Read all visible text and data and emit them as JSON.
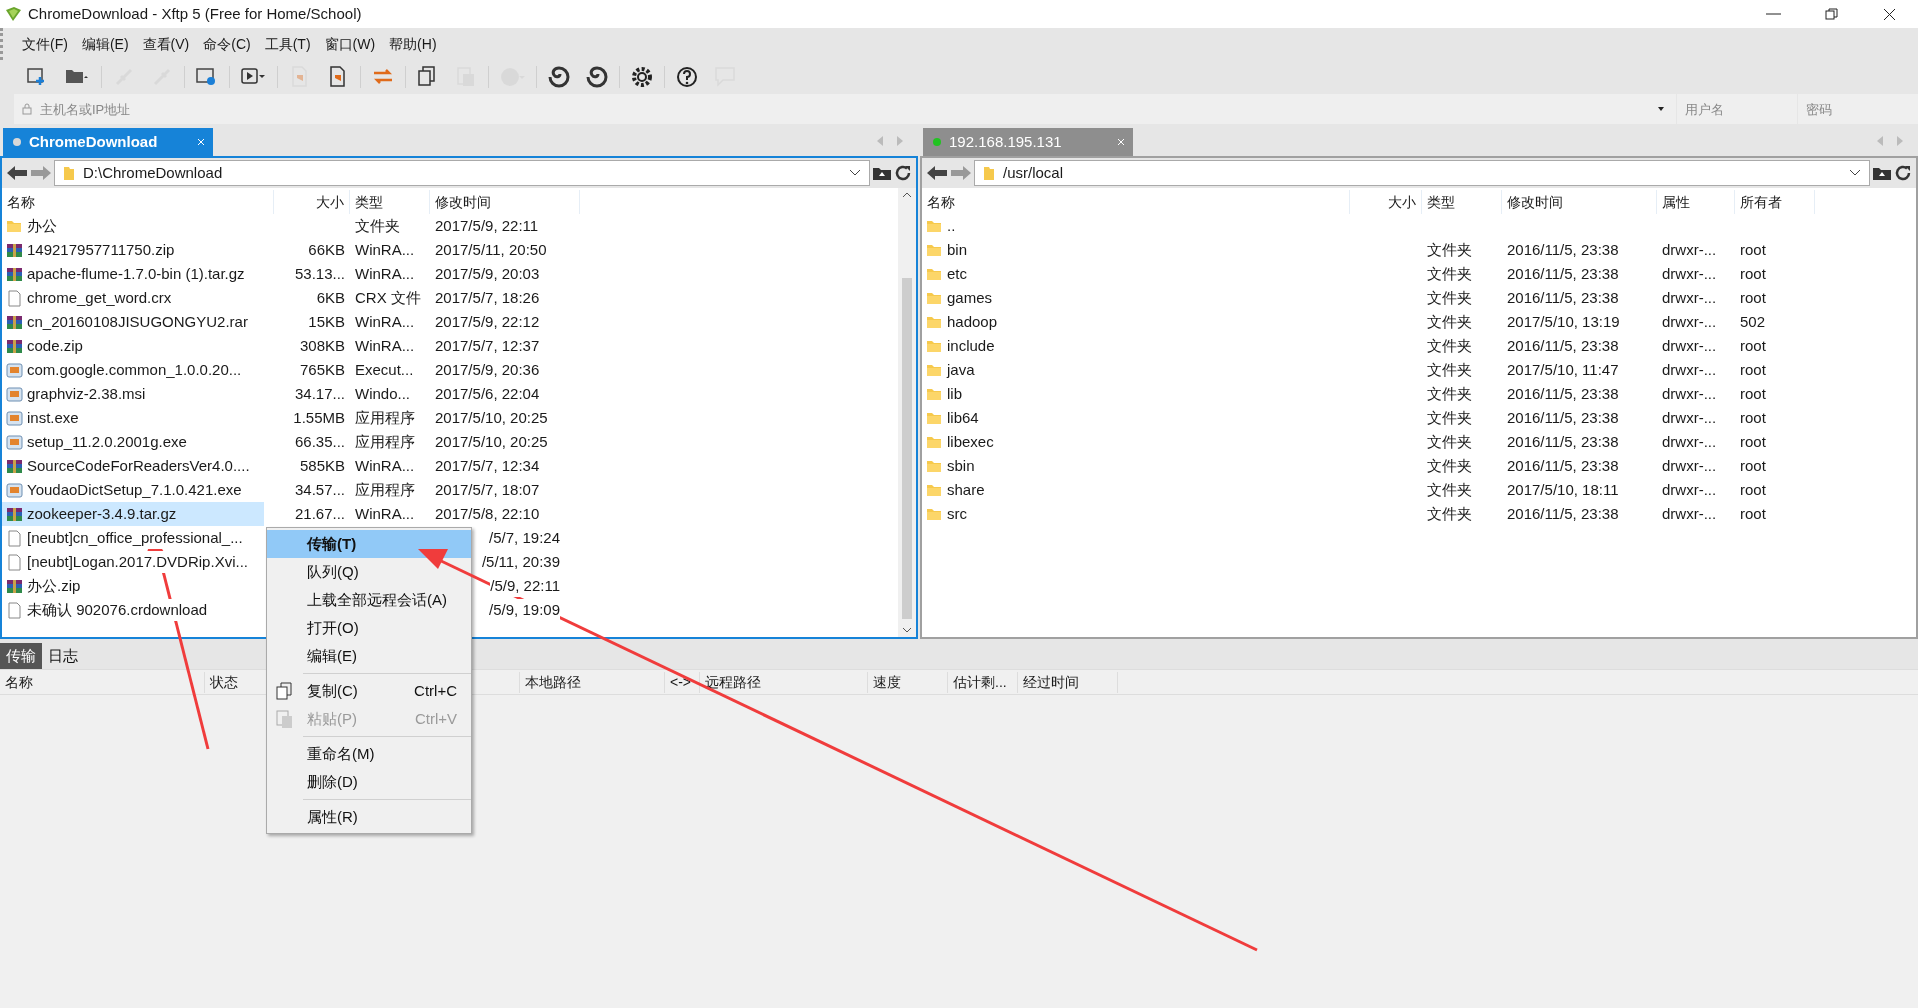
{
  "window": {
    "title": "ChromeDownload - Xftp 5 (Free for Home/School)"
  },
  "menu": [
    "文件(F)",
    "编辑(E)",
    "查看(V)",
    "命令(C)",
    "工具(T)",
    "窗口(W)",
    "帮助(H)"
  ],
  "toolbar": [
    {
      "kind": "new",
      "disabled": false
    },
    {
      "kind": "open",
      "disabled": false
    },
    {
      "kind": "connect",
      "disabled": true
    },
    {
      "kind": "disconnect",
      "disabled": true
    },
    {
      "kind": "properties",
      "disabled": false
    },
    {
      "kind": "play",
      "disabled": false
    },
    {
      "kind": "doc",
      "disabled": true
    },
    {
      "kind": "doc",
      "disabled": false
    },
    {
      "kind": "swap",
      "disabled": false
    },
    {
      "kind": "copy",
      "disabled": false
    },
    {
      "kind": "paste",
      "disabled": true
    },
    {
      "kind": "globe",
      "disabled": true
    },
    {
      "kind": "shell",
      "disabled": false
    },
    {
      "kind": "shell",
      "disabled": false
    },
    {
      "kind": "gear",
      "disabled": false
    },
    {
      "kind": "help",
      "disabled": false
    },
    {
      "kind": "chat",
      "disabled": true
    }
  ],
  "address_bar": {
    "host_placeholder": "主机名或IP地址",
    "user_placeholder": "用户名",
    "password_placeholder": "密码"
  },
  "local": {
    "tab": {
      "label": "ChromeDownload",
      "selected": true
    },
    "path": "D:\\ChromeDownload",
    "columns": [
      "名称",
      "大小",
      "类型",
      "修改时间"
    ],
    "rows": [
      {
        "kind": "folder",
        "name": "办公",
        "size": "",
        "type": "文件夹",
        "modified": "2017/5/9, 22:11",
        "selected": false
      },
      {
        "kind": "archive",
        "name": "149217957711750.zip",
        "size": "66KB",
        "type": "WinRA...",
        "modified": "2017/5/11, 20:50",
        "selected": false
      },
      {
        "kind": "archive",
        "name": "apache-flume-1.7.0-bin (1).tar.gz",
        "size": "53.13...",
        "type": "WinRA...",
        "modified": "2017/5/9, 20:03",
        "selected": false
      },
      {
        "kind": "file",
        "name": "chrome_get_word.crx",
        "size": "6KB",
        "type": "CRX 文件",
        "modified": "2017/5/7, 18:26",
        "selected": false
      },
      {
        "kind": "archive",
        "name": "cn_20160108JISUGONGYU2.rar",
        "size": "15KB",
        "type": "WinRA...",
        "modified": "2017/5/9, 22:12",
        "selected": false
      },
      {
        "kind": "archive",
        "name": "code.zip",
        "size": "308KB",
        "type": "WinRA...",
        "modified": "2017/5/7, 12:37",
        "selected": false
      },
      {
        "kind": "app",
        "name": "com.google.common_1.0.0.20...",
        "size": "765KB",
        "type": "Execut...",
        "modified": "2017/5/9, 20:36",
        "selected": false
      },
      {
        "kind": "app",
        "name": "graphviz-2.38.msi",
        "size": "34.17...",
        "type": "Windo...",
        "modified": "2017/5/6, 22:04",
        "selected": false
      },
      {
        "kind": "app",
        "name": "inst.exe",
        "size": "1.55MB",
        "type": "应用程序",
        "modified": "2017/5/10, 20:25",
        "selected": false
      },
      {
        "kind": "app",
        "name": "setup_11.2.0.2001g.exe",
        "size": "66.35...",
        "type": "应用程序",
        "modified": "2017/5/10, 20:25",
        "selected": false
      },
      {
        "kind": "archive",
        "name": "SourceCodeForReadersVer4.0....",
        "size": "585KB",
        "type": "WinRA...",
        "modified": "2017/5/7, 12:34",
        "selected": false
      },
      {
        "kind": "app",
        "name": "YoudaoDictSetup_7.1.0.421.exe",
        "size": "34.57...",
        "type": "应用程序",
        "modified": "2017/5/7, 18:07",
        "selected": false
      },
      {
        "kind": "archive",
        "name": "zookeeper-3.4.9.tar.gz",
        "size": "21.67...",
        "type": "WinRA...",
        "modified": "2017/5/8, 22:10",
        "selected": true
      },
      {
        "kind": "file",
        "name": "[neubt]cn_office_professional_...",
        "modified": "/5/7, 19:24",
        "selected": false
      },
      {
        "kind": "file",
        "name": "[neubt]Logan.2017.DVDRip.Xvi...",
        "modified": "/5/11, 20:39",
        "selected": false
      },
      {
        "kind": "archive",
        "name": "办公.zip",
        "modified": "/5/9, 22:11",
        "selected": false
      },
      {
        "kind": "file",
        "name": "未确认 902076.crdownload",
        "modified": "/5/9, 19:09",
        "selected": false
      }
    ]
  },
  "remote": {
    "tab": {
      "label": "192.168.195.131",
      "selected": false,
      "connected": true
    },
    "path": "/usr/local",
    "columns": [
      "名称",
      "大小",
      "类型",
      "修改时间",
      "属性",
      "所有者"
    ],
    "rows": [
      {
        "name": ".."
      },
      {
        "name": "bin",
        "type": "文件夹",
        "modified": "2016/11/5, 23:38",
        "attributes": "drwxr-...",
        "owner": "root"
      },
      {
        "name": "etc",
        "type": "文件夹",
        "modified": "2016/11/5, 23:38",
        "attributes": "drwxr-...",
        "owner": "root"
      },
      {
        "name": "games",
        "type": "文件夹",
        "modified": "2016/11/5, 23:38",
        "attributes": "drwxr-...",
        "owner": "root"
      },
      {
        "name": "hadoop",
        "type": "文件夹",
        "modified": "2017/5/10, 13:19",
        "attributes": "drwxr-...",
        "owner": "502"
      },
      {
        "name": "include",
        "type": "文件夹",
        "modified": "2016/11/5, 23:38",
        "attributes": "drwxr-...",
        "owner": "root"
      },
      {
        "name": "java",
        "type": "文件夹",
        "modified": "2017/5/10, 11:47",
        "attributes": "drwxr-...",
        "owner": "root"
      },
      {
        "name": "lib",
        "type": "文件夹",
        "modified": "2016/11/5, 23:38",
        "attributes": "drwxr-...",
        "owner": "root"
      },
      {
        "name": "lib64",
        "type": "文件夹",
        "modified": "2016/11/5, 23:38",
        "attributes": "drwxr-...",
        "owner": "root"
      },
      {
        "name": "libexec",
        "type": "文件夹",
        "modified": "2016/11/5, 23:38",
        "attributes": "drwxr-...",
        "owner": "root"
      },
      {
        "name": "sbin",
        "type": "文件夹",
        "modified": "2016/11/5, 23:38",
        "attributes": "drwxr-...",
        "owner": "root"
      },
      {
        "name": "share",
        "type": "文件夹",
        "modified": "2017/5/10, 18:11",
        "attributes": "drwxr-...",
        "owner": "root"
      },
      {
        "name": "src",
        "type": "文件夹",
        "modified": "2016/11/5, 23:38",
        "attributes": "drwxr-...",
        "owner": "root"
      }
    ]
  },
  "bottom_tabs": [
    {
      "label": "传输",
      "selected": true
    },
    {
      "label": "日志",
      "selected": false
    }
  ],
  "transfer_columns": [
    "名称",
    "状态",
    "本地路径",
    "<->",
    "远程路径",
    "速度",
    "估计剩...",
    "经过时间"
  ],
  "context_menu": [
    {
      "kind": "item",
      "label": "传输(T)",
      "selected": true,
      "disabled": false
    },
    {
      "kind": "item",
      "label": "队列(Q)",
      "selected": false,
      "disabled": false
    },
    {
      "kind": "item",
      "label": "上载全部远程会话(A)",
      "selected": false,
      "disabled": false
    },
    {
      "kind": "item",
      "label": "打开(O)",
      "selected": false,
      "disabled": false
    },
    {
      "kind": "item",
      "label": "编辑(E)",
      "selected": false,
      "disabled": false
    },
    {
      "kind": "separator"
    },
    {
      "kind": "copy",
      "label": "复制(C)",
      "shortcut": "Ctrl+C",
      "selected": false,
      "disabled": false
    },
    {
      "kind": "paste",
      "label": "粘贴(P)",
      "shortcut": "Ctrl+V",
      "selected": false,
      "disabled": true
    },
    {
      "kind": "separator"
    },
    {
      "kind": "item",
      "label": "重命名(M)",
      "selected": false,
      "disabled": false
    },
    {
      "kind": "item",
      "label": "删除(D)",
      "selected": false,
      "disabled": false
    },
    {
      "kind": "separator"
    },
    {
      "kind": "item",
      "label": "属性(R)",
      "selected": false,
      "disabled": false
    }
  ]
}
